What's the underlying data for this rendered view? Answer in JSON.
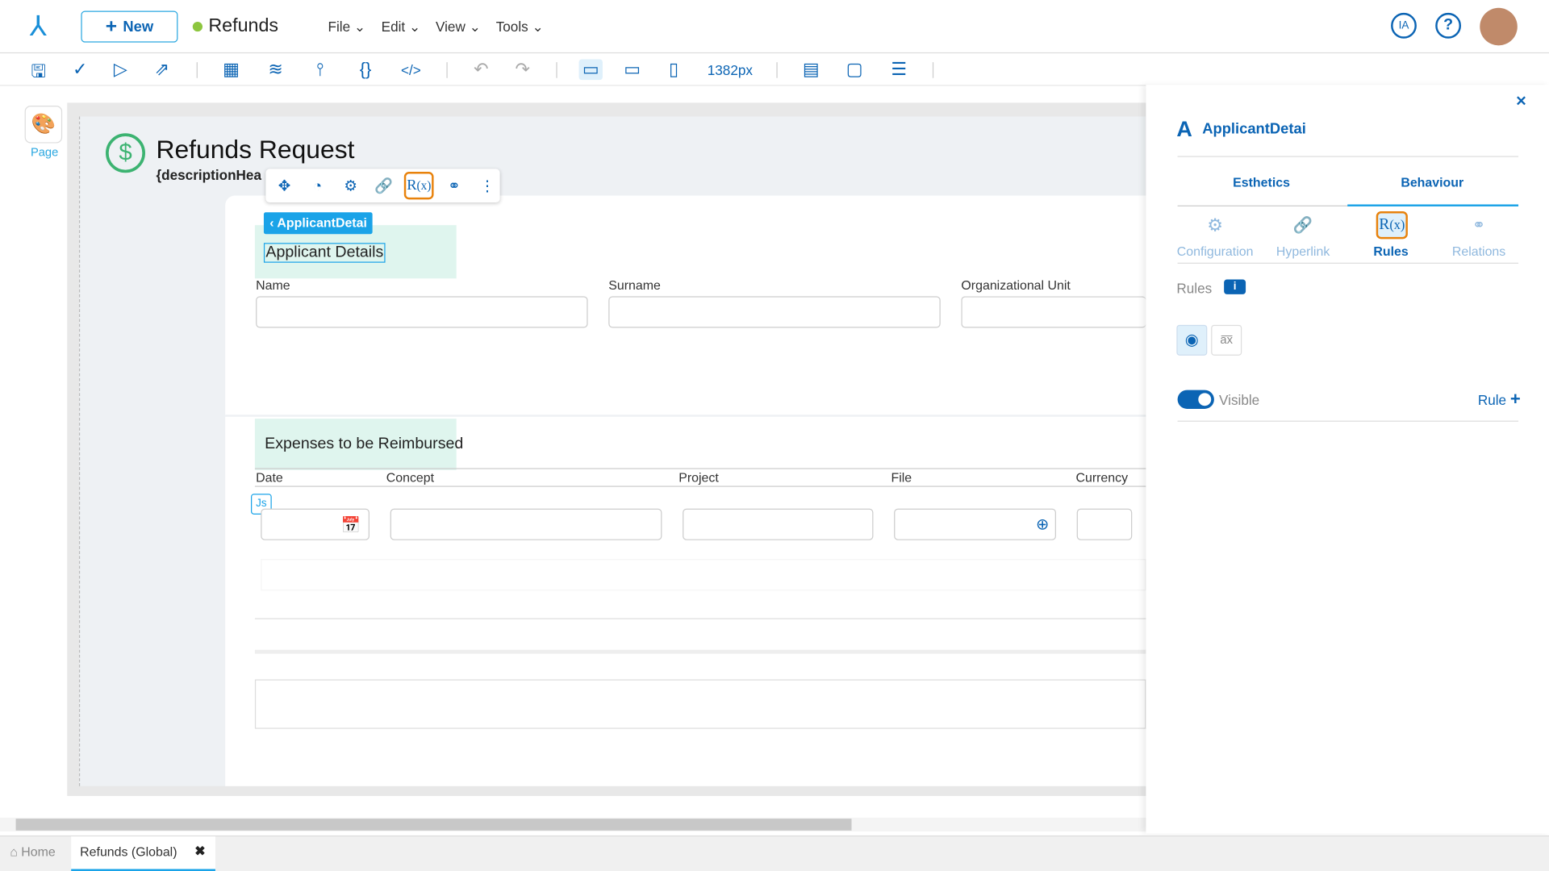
{
  "header": {
    "new_label": "New",
    "app_title": "Refunds",
    "menus": [
      "File",
      "Edit",
      "View",
      "Tools"
    ],
    "ia_label": "IA"
  },
  "toolbar": {
    "width_readout": "1382px"
  },
  "left": {
    "page_label": "Page"
  },
  "form": {
    "title": "Refunds Request",
    "subtitle": "{descriptionHea",
    "breadcrumb": "ApplicantDetai",
    "section1": "Applicant Details",
    "fields": [
      "Name",
      "Surname",
      "Organizational Unit"
    ],
    "section2": "Expenses to be Reimbursed",
    "columns": [
      "Date",
      "Concept",
      "Project",
      "File",
      "Currency"
    ],
    "js_badge": "Js"
  },
  "panel": {
    "title": "ApplicantDetai",
    "tabs": [
      "Esthetics",
      "Behaviour"
    ],
    "subtabs": [
      "Configuration",
      "Hyperlink",
      "Rules",
      "Relations"
    ],
    "rules_label": "Rules",
    "visible_label": "Visible",
    "visible_on": true,
    "rule_button": "Rule"
  },
  "bottom_tabs": {
    "home": "Home",
    "active": "Refunds (Global)"
  },
  "colors": {
    "accent": "#0b64b4",
    "highlight": "#e8820c",
    "status": "#8dc63f"
  }
}
